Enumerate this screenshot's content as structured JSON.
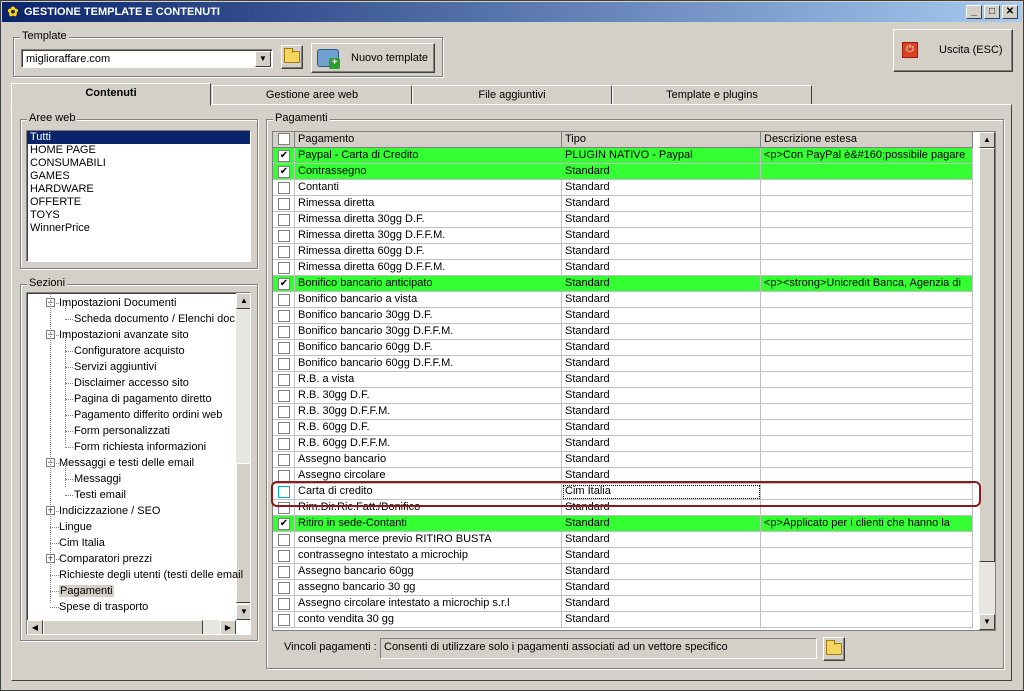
{
  "window": {
    "title": "GESTIONE TEMPLATE E CONTENUTI",
    "min": "_",
    "max": "□",
    "close": "✕"
  },
  "template": {
    "group_label": "Template",
    "selected": "miglioraffare.com",
    "new_button": "Nuovo template"
  },
  "exit_button": "Uscita (ESC)",
  "tabs": [
    "Contenuti",
    "Gestione aree web",
    "File aggiuntivi",
    "Template e plugins"
  ],
  "aree_web": {
    "label": "Aree web",
    "items": [
      "Tutti",
      "HOME PAGE",
      "CONSUMABILI",
      "GAMES",
      "HARDWARE",
      "OFFERTE",
      "TOYS",
      "WinnerPrice"
    ],
    "selected_index": 0
  },
  "sezioni": {
    "label": "Sezioni",
    "nodes": [
      {
        "text": "Impostazioni Documenti",
        "level": 1,
        "exp": "−"
      },
      {
        "text": "Scheda documento / Elenchi doc",
        "level": 2
      },
      {
        "text": "Impostazioni avanzate sito",
        "level": 1,
        "exp": "−"
      },
      {
        "text": "Configuratore acquisto",
        "level": 2
      },
      {
        "text": "Servizi aggiuntivi",
        "level": 2
      },
      {
        "text": "Disclaimer accesso sito",
        "level": 2
      },
      {
        "text": "Pagina di pagamento diretto",
        "level": 2
      },
      {
        "text": "Pagamento differito ordini web",
        "level": 2
      },
      {
        "text": "Form personalizzati",
        "level": 2
      },
      {
        "text": "Form richiesta informazioni",
        "level": 2
      },
      {
        "text": "Messaggi e testi delle email",
        "level": 1,
        "exp": "−"
      },
      {
        "text": "Messaggi",
        "level": 2
      },
      {
        "text": "Testi email",
        "level": 2
      },
      {
        "text": "Indicizzazione / SEO",
        "level": 1,
        "exp": "+"
      },
      {
        "text": "Lingue",
        "level": 1
      },
      {
        "text": "Cim Italia",
        "level": 1
      },
      {
        "text": "Comparatori prezzi",
        "level": 1,
        "exp": "+"
      },
      {
        "text": "Richieste degli utenti (testi delle email",
        "level": 1
      },
      {
        "text": "Pagamenti",
        "level": 1,
        "selected": true
      },
      {
        "text": "Spese di trasporto",
        "level": 1
      }
    ]
  },
  "pagamenti": {
    "label": "Pagamenti",
    "columns": [
      "Pagamento",
      "Tipo",
      "Descrizione estesa"
    ],
    "rows": [
      {
        "checked": true,
        "green": true,
        "pagamento": "Paypal - Carta di Credito",
        "tipo": "PLUGIN NATIVO - Paypal",
        "desc": "<p>Con PayPal è&#160;possibile pagare"
      },
      {
        "checked": true,
        "green": true,
        "pagamento": "Contrassegno",
        "tipo": "Standard",
        "desc": ""
      },
      {
        "checked": false,
        "green": false,
        "pagamento": "Contanti",
        "tipo": "Standard",
        "desc": ""
      },
      {
        "checked": false,
        "green": false,
        "pagamento": "Rimessa diretta",
        "tipo": "Standard",
        "desc": ""
      },
      {
        "checked": false,
        "green": false,
        "pagamento": "Rimessa diretta 30gg D.F.",
        "tipo": "Standard",
        "desc": ""
      },
      {
        "checked": false,
        "green": false,
        "pagamento": "Rimessa diretta 30gg D.F.F.M.",
        "tipo": "Standard",
        "desc": ""
      },
      {
        "checked": false,
        "green": false,
        "pagamento": "Rimessa diretta 60gg D.F.",
        "tipo": "Standard",
        "desc": ""
      },
      {
        "checked": false,
        "green": false,
        "pagamento": "Rimessa diretta 60gg D.F.F.M.",
        "tipo": "Standard",
        "desc": ""
      },
      {
        "checked": true,
        "green": true,
        "pagamento": "Bonifico bancario anticipato",
        "tipo": "Standard",
        "desc": "<p><strong>Unicredit Banca, Agenzia di"
      },
      {
        "checked": false,
        "green": false,
        "pagamento": "Bonifico bancario a vista",
        "tipo": "Standard",
        "desc": ""
      },
      {
        "checked": false,
        "green": false,
        "pagamento": "Bonifico bancario 30gg D.F.",
        "tipo": "Standard",
        "desc": ""
      },
      {
        "checked": false,
        "green": false,
        "pagamento": "Bonifico bancario 30gg D.F.F.M.",
        "tipo": "Standard",
        "desc": ""
      },
      {
        "checked": false,
        "green": false,
        "pagamento": "Bonifico bancario 60gg D.F.",
        "tipo": "Standard",
        "desc": ""
      },
      {
        "checked": false,
        "green": false,
        "pagamento": "Bonifico bancario 60gg D.F.F.M.",
        "tipo": "Standard",
        "desc": ""
      },
      {
        "checked": false,
        "green": false,
        "pagamento": "R.B. a vista",
        "tipo": "Standard",
        "desc": ""
      },
      {
        "checked": false,
        "green": false,
        "pagamento": "R.B. 30gg D.F.",
        "tipo": "Standard",
        "desc": ""
      },
      {
        "checked": false,
        "green": false,
        "pagamento": "R.B. 30gg D.F.F.M.",
        "tipo": "Standard",
        "desc": ""
      },
      {
        "checked": false,
        "green": false,
        "pagamento": "R.B. 60gg D.F.",
        "tipo": "Standard",
        "desc": ""
      },
      {
        "checked": false,
        "green": false,
        "pagamento": "R.B. 60gg D.F.F.M.",
        "tipo": "Standard",
        "desc": ""
      },
      {
        "checked": false,
        "green": false,
        "pagamento": "Assegno bancario",
        "tipo": "Standard",
        "desc": ""
      },
      {
        "checked": false,
        "green": false,
        "pagamento": "Assegno circolare",
        "tipo": "Standard",
        "desc": ""
      },
      {
        "checked": false,
        "green": false,
        "pagamento": "Carta di credito",
        "tipo": "Cim Italia",
        "desc": "",
        "highlight": true
      },
      {
        "checked": false,
        "green": false,
        "pagamento": "Rim.Dir.Ric.Fatt./Bonifico",
        "tipo": "Standard",
        "desc": ""
      },
      {
        "checked": true,
        "green": true,
        "pagamento": "Ritiro in sede-Contanti",
        "tipo": "Standard",
        "desc": "<p>Applicato per i clienti che hanno la"
      },
      {
        "checked": false,
        "green": false,
        "pagamento": "consegna merce previo RITIRO BUSTA",
        "tipo": "Standard",
        "desc": ""
      },
      {
        "checked": false,
        "green": false,
        "pagamento": "contrassegno intestato a microchip",
        "tipo": "Standard",
        "desc": ""
      },
      {
        "checked": false,
        "green": false,
        "pagamento": "Assegno bancario 60gg",
        "tipo": "Standard",
        "desc": ""
      },
      {
        "checked": false,
        "green": false,
        "pagamento": "assegno bancario 30 gg",
        "tipo": "Standard",
        "desc": ""
      },
      {
        "checked": false,
        "green": false,
        "pagamento": "Assegno circolare intestato a microchip s.r.l",
        "tipo": "Standard",
        "desc": ""
      },
      {
        "checked": false,
        "green": false,
        "pagamento": "conto vendita 30 gg",
        "tipo": "Standard",
        "desc": ""
      }
    ]
  },
  "vincoli": {
    "label": "Vincoli pagamenti :",
    "value": "Consenti di utilizzare solo i pagamenti associati ad un vettore specifico"
  }
}
